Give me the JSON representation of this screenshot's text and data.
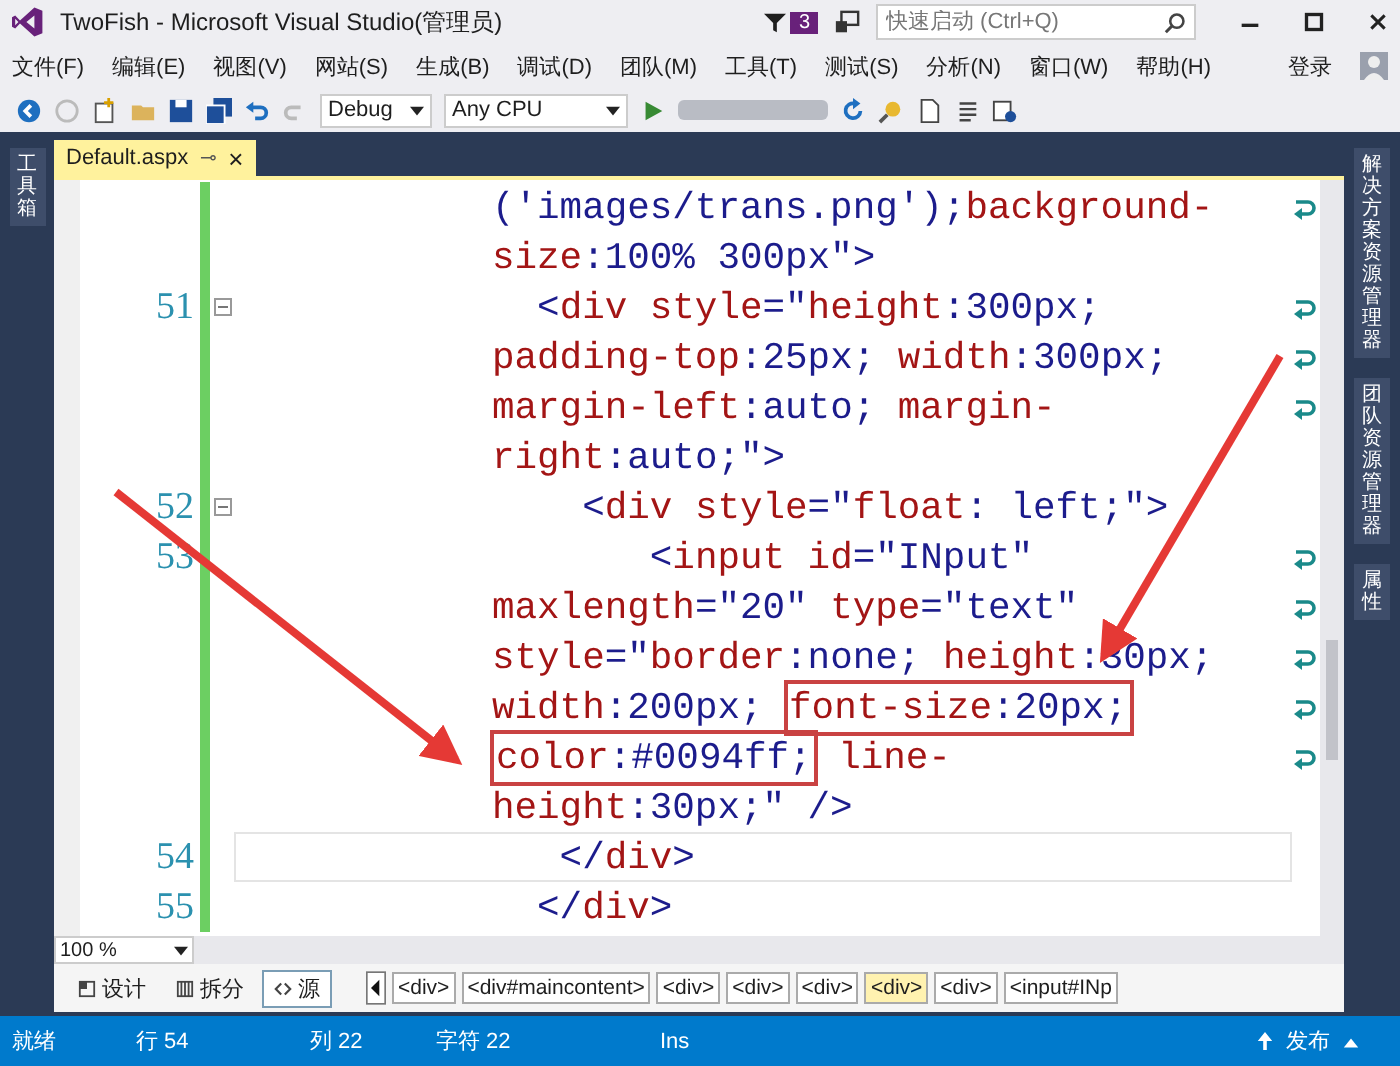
{
  "window": {
    "title": "TwoFish - Microsoft Visual Studio(管理员)",
    "notification_count": "3",
    "quick_launch": {
      "placeholder": "快速启动 (Ctrl+Q)"
    }
  },
  "menu": {
    "items": [
      "文件(F)",
      "编辑(E)",
      "视图(V)",
      "网站(S)",
      "生成(B)",
      "调试(D)",
      "团队(M)",
      "工具(T)",
      "测试(S)",
      "分析(N)",
      "窗口(W)",
      "帮助(H)"
    ],
    "sign_in": "登录"
  },
  "toolbar": {
    "configuration": "Debug",
    "platform": "Any CPU"
  },
  "left_panel": {
    "label": "工具箱"
  },
  "right_panel": {
    "labels": [
      "解决方案资源管理器",
      "团队资源管理器",
      "属性"
    ]
  },
  "editor_tab": {
    "label": "Default.aspx",
    "pin": "⊸",
    "close": "×"
  },
  "code_lines": [
    {
      "fold": false,
      "wrapped": true,
      "current": false,
      "tokens": [
        {
          "kind": "value",
          "text": "('images/trans.png');"
        },
        {
          "kind": "name",
          "text": "background-"
        }
      ]
    },
    {
      "fold": false,
      "wrapped": false,
      "current": false,
      "tokens": [
        {
          "kind": "name",
          "text": "size"
        },
        {
          "kind": "value",
          "text": ":100% 300px\">"
        }
      ]
    },
    {
      "number": "51",
      "fold": true,
      "wrapped": true,
      "current": false,
      "tokens": [
        {
          "kind": "value",
          "text": "  <"
        },
        {
          "kind": "name",
          "text": "div style"
        },
        {
          "kind": "value",
          "text": "=\""
        },
        {
          "kind": "name",
          "text": "height"
        },
        {
          "kind": "value",
          "text": ":300px;"
        }
      ]
    },
    {
      "fold": false,
      "wrapped": true,
      "current": false,
      "tokens": [
        {
          "kind": "name",
          "text": "padding-top"
        },
        {
          "kind": "value",
          "text": ":25px; "
        },
        {
          "kind": "name",
          "text": "width"
        },
        {
          "kind": "value",
          "text": ":300px;"
        }
      ]
    },
    {
      "fold": false,
      "wrapped": true,
      "current": false,
      "tokens": [
        {
          "kind": "name",
          "text": "margin-left"
        },
        {
          "kind": "value",
          "text": ":auto; "
        },
        {
          "kind": "name",
          "text": "margin-"
        }
      ]
    },
    {
      "fold": false,
      "wrapped": false,
      "current": false,
      "tokens": [
        {
          "kind": "name",
          "text": "right"
        },
        {
          "kind": "value",
          "text": ":auto;\">"
        }
      ]
    },
    {
      "number": "52",
      "fold": true,
      "wrapped": false,
      "current": false,
      "tokens": [
        {
          "kind": "value",
          "text": "    <"
        },
        {
          "kind": "name",
          "text": "div style"
        },
        {
          "kind": "value",
          "text": "=\""
        },
        {
          "kind": "name",
          "text": "float"
        },
        {
          "kind": "value",
          "text": ": left;\">"
        }
      ]
    },
    {
      "number": "53",
      "fold": false,
      "wrapped": true,
      "current": false,
      "tokens": [
        {
          "kind": "value",
          "text": "       <"
        },
        {
          "kind": "name",
          "text": "input id"
        },
        {
          "kind": "value",
          "text": "=\"INput\""
        }
      ]
    },
    {
      "fold": false,
      "wrapped": true,
      "current": false,
      "tokens": [
        {
          "kind": "name",
          "text": "maxlength"
        },
        {
          "kind": "value",
          "text": "=\"20\" "
        },
        {
          "kind": "name",
          "text": "type"
        },
        {
          "kind": "value",
          "text": "=\"text\""
        }
      ]
    },
    {
      "fold": false,
      "wrapped": true,
      "current": false,
      "tokens": [
        {
          "kind": "name",
          "text": "style"
        },
        {
          "kind": "value",
          "text": "=\""
        },
        {
          "kind": "name",
          "text": "border"
        },
        {
          "kind": "value",
          "text": ":none; "
        },
        {
          "kind": "name",
          "text": "height"
        },
        {
          "kind": "value",
          "text": ":30px;"
        }
      ]
    },
    {
      "fold": false,
      "wrapped": true,
      "current": false,
      "tokens": [
        {
          "kind": "name",
          "text": "width"
        },
        {
          "kind": "value",
          "text": ":200px; "
        },
        {
          "kind": "box",
          "tokens": [
            {
              "kind": "name",
              "text": "font-size"
            },
            {
              "kind": "value",
              "text": ":20px;"
            }
          ]
        }
      ]
    },
    {
      "fold": false,
      "wrapped": true,
      "current": false,
      "tokens": [
        {
          "kind": "box",
          "tokens": [
            {
              "kind": "name",
              "text": "color"
            },
            {
              "kind": "value",
              "text": ":#0094ff;"
            }
          ]
        },
        {
          "kind": "name",
          "text": " line-"
        }
      ]
    },
    {
      "fold": false,
      "wrapped": false,
      "current": false,
      "tokens": [
        {
          "kind": "name",
          "text": "height"
        },
        {
          "kind": "value",
          "text": ":30px;\" />"
        }
      ]
    },
    {
      "number": "54",
      "fold": false,
      "wrapped": false,
      "current": true,
      "tokens": [
        {
          "kind": "value",
          "text": "   </"
        },
        {
          "kind": "name",
          "text": "div"
        },
        {
          "kind": "value",
          "text": ">"
        }
      ]
    },
    {
      "number": "55",
      "fold": false,
      "wrapped": false,
      "current": false,
      "tokens": [
        {
          "kind": "value",
          "text": "  </"
        },
        {
          "kind": "name",
          "text": "div"
        },
        {
          "kind": "value",
          "text": ">"
        }
      ]
    }
  ],
  "zoom": {
    "value": "100 %"
  },
  "view_tabs": [
    {
      "label": "设计",
      "selected": false
    },
    {
      "label": "拆分",
      "selected": false
    },
    {
      "label": "源",
      "selected": true
    }
  ],
  "breadcrumb": [
    {
      "label": "<div>",
      "selected": false
    },
    {
      "label": "<div#maincontent>",
      "selected": false
    },
    {
      "label": "<div>",
      "selected": false
    },
    {
      "label": "<div>",
      "selected": false
    },
    {
      "label": "<div>",
      "selected": false
    },
    {
      "label": "<div>",
      "selected": true
    },
    {
      "label": "<div>",
      "selected": false
    },
    {
      "label": "<input#INp",
      "selected": false
    }
  ],
  "status_bar": {
    "state": "就绪",
    "row": "行 54",
    "column": "列 22",
    "char": "字符 22",
    "mode": "Ins",
    "publish": "发布"
  }
}
